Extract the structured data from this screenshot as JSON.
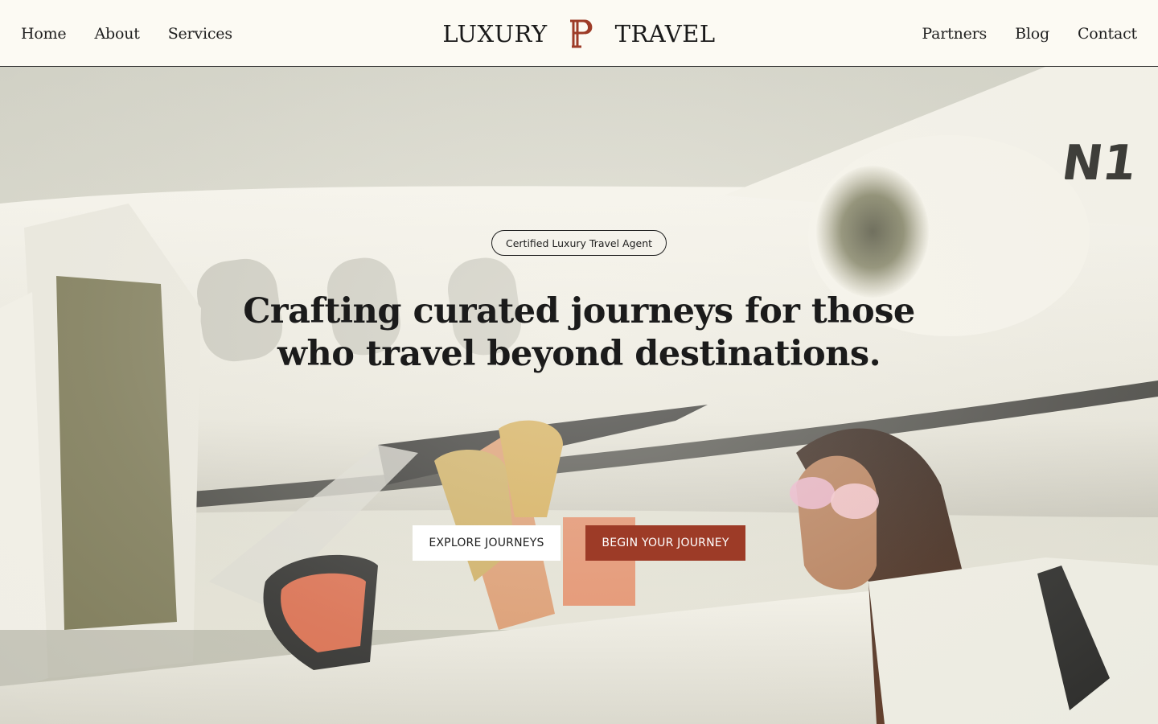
{
  "header": {
    "nav_left": [
      "Home",
      "About",
      "Services"
    ],
    "nav_right": [
      "Partners",
      "Blog",
      "Contact"
    ],
    "brand_left": "LUXURY",
    "brand_right": "TRAVEL",
    "brand_mark_icon": "monogram-p-icon",
    "brand_mark_color": "#9d3b27"
  },
  "hero": {
    "badge": "Certified Luxury Travel Agent",
    "headline_line1": "Crafting curated journeys for those",
    "headline_line2": "who travel beyond destinations.",
    "cta_secondary": "EXPLORE JOURNEYS",
    "cta_primary": "BEGIN YOUR JOURNEY",
    "tail_marking": "N1",
    "colors": {
      "accent": "#9d3b27",
      "background": "#fcfaf3",
      "text": "#1e1e1e"
    }
  }
}
